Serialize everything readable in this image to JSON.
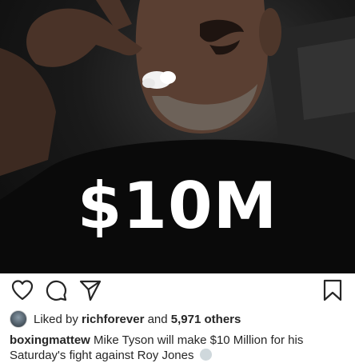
{
  "post": {
    "overlay_text": "$10M"
  },
  "actions": {
    "like_icon": "heart-icon",
    "comment_icon": "comment-icon",
    "share_icon": "share-icon",
    "save_icon": "bookmark-icon"
  },
  "likes": {
    "prefix": "Liked by",
    "user": "richforever",
    "and": "and",
    "count": "5,971 others"
  },
  "caption": {
    "username": "boxingmattew",
    "text": "Mike Tyson will make $10 Million for his Saturday's fight against Roy Jones",
    "emoji": "astonished-emoji"
  }
}
